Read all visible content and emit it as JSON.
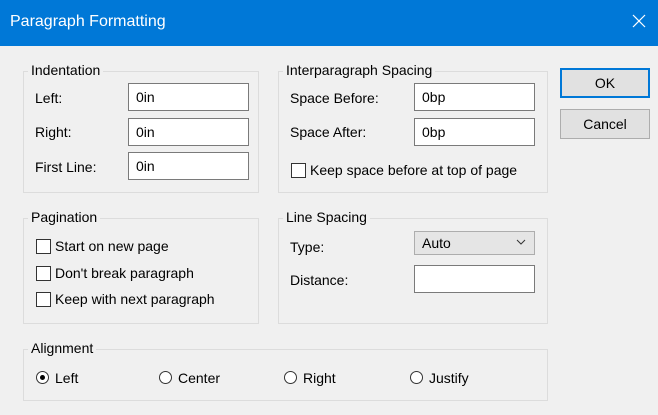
{
  "window": {
    "title": "Paragraph Formatting"
  },
  "buttons": {
    "ok": "OK",
    "cancel": "Cancel"
  },
  "indentation": {
    "legend": "Indentation",
    "left": {
      "label": "Left:",
      "value": "0in"
    },
    "right": {
      "label": "Right:",
      "value": "0in"
    },
    "first_line": {
      "label": "First Line:",
      "value": "0in"
    }
  },
  "spacing": {
    "legend": "Interparagraph Spacing",
    "before": {
      "label": "Space Before:",
      "value": "0bp"
    },
    "after": {
      "label": "Space After:",
      "value": "0bp"
    },
    "keep_top": {
      "label": "Keep space before at top of page",
      "checked": false
    }
  },
  "pagination": {
    "legend": "Pagination",
    "options": [
      {
        "label": "Start on new page",
        "checked": false
      },
      {
        "label": "Don't break paragraph",
        "checked": false
      },
      {
        "label": "Keep with next paragraph",
        "checked": false
      }
    ]
  },
  "line_spacing": {
    "legend": "Line Spacing",
    "type": {
      "label": "Type:",
      "value": "Auto"
    },
    "distance": {
      "label": "Distance:",
      "value": ""
    }
  },
  "alignment": {
    "legend": "Alignment",
    "selected": "Left",
    "options": [
      {
        "label": "Left"
      },
      {
        "label": "Center"
      },
      {
        "label": "Right"
      },
      {
        "label": "Justify"
      }
    ]
  }
}
